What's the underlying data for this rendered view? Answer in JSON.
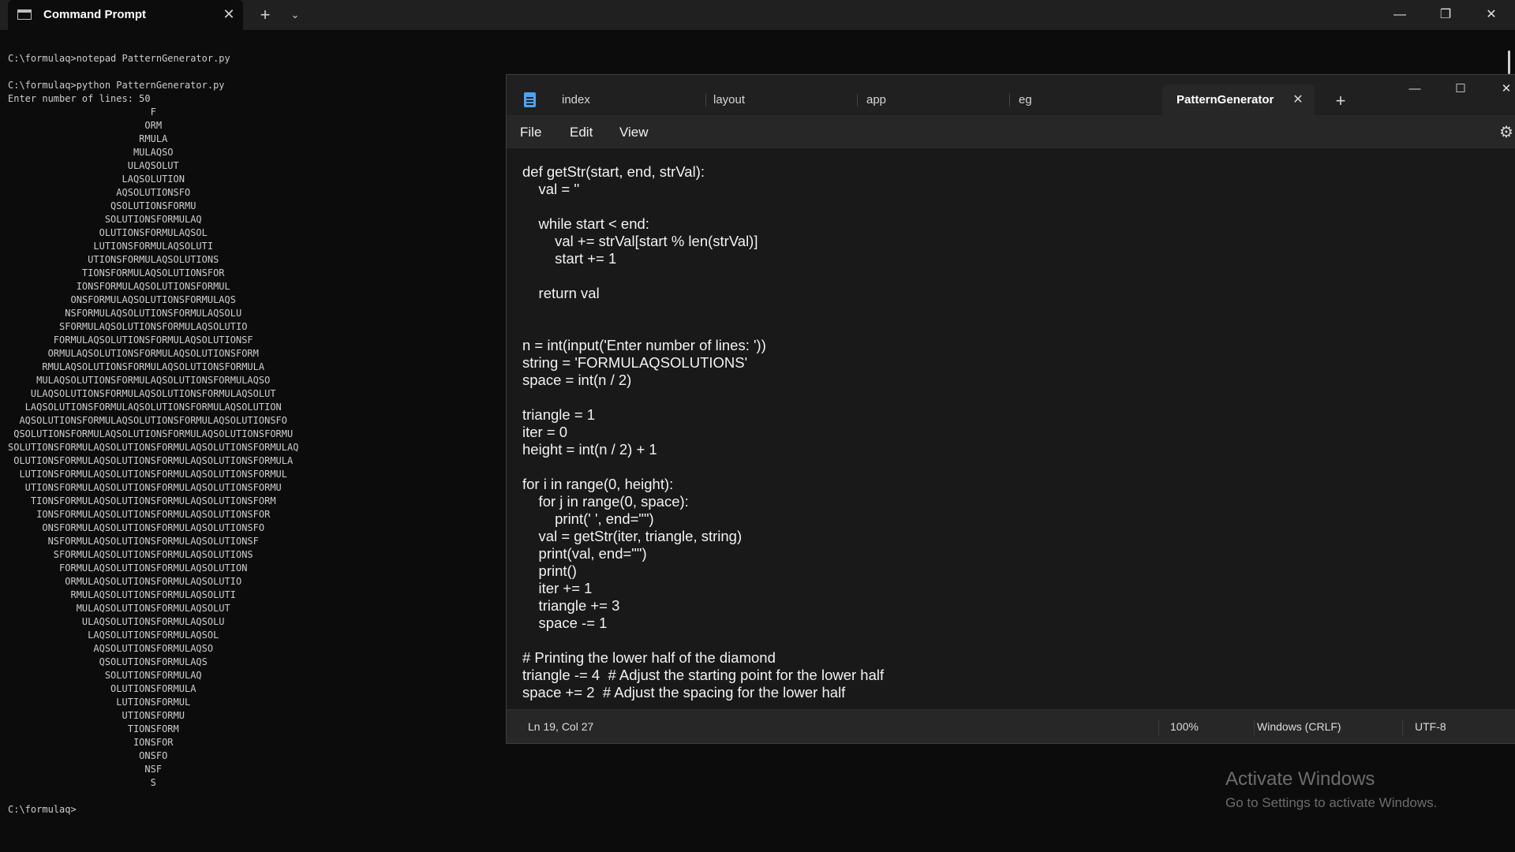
{
  "terminal": {
    "tab_title": "Command Prompt",
    "icons": {
      "tab": "terminal-icon",
      "close": "close-icon",
      "new_tab": "plus-icon",
      "dropdown": "chevron-down-icon",
      "minimize": "minimize-icon",
      "restore": "restore-icon",
      "window_close": "close-icon"
    },
    "output_lines": [
      "C:\\formulaq>notepad PatternGenerator.py",
      "",
      "C:\\formulaq>python PatternGenerator.py",
      "Enter number of lines: 50",
      "                         F",
      "                        ORM",
      "                       RMULA",
      "                      MULAQSO",
      "                     ULAQSOLUT",
      "                    LAQSOLUTION",
      "                   AQSOLUTIONSFO",
      "                  QSOLUTIONSFORMU",
      "                 SOLUTIONSFORMULAQ",
      "                OLUTIONSFORMULAQSOL",
      "               LUTIONSFORMULAQSOLUTI",
      "              UTIONSFORMULAQSOLUTIONS",
      "             TIONSFORMULAQSOLUTIONSFOR",
      "            IONSFORMULAQSOLUTIONSFORMUL",
      "           ONSFORMULAQSOLUTIONSFORMULAQS",
      "          NSFORMULAQSOLUTIONSFORMULAQSOLU",
      "         SFORMULAQSOLUTIONSFORMULAQSOLUTIO",
      "        FORMULAQSOLUTIONSFORMULAQSOLUTIONSF",
      "       ORMULAQSOLUTIONSFORMULAQSOLUTIONSFORM",
      "      RMULAQSOLUTIONSFORMULAQSOLUTIONSFORMULA",
      "     MULAQSOLUTIONSFORMULAQSOLUTIONSFORMULAQSO",
      "    ULAQSOLUTIONSFORMULAQSOLUTIONSFORMULAQSOLUT",
      "   LAQSOLUTIONSFORMULAQSOLUTIONSFORMULAQSOLUTION",
      "  AQSOLUTIONSFORMULAQSOLUTIONSFORMULAQSOLUTIONSFO",
      " QSOLUTIONSFORMULAQSOLUTIONSFORMULAQSOLUTIONSFORMU",
      "SOLUTIONSFORMULAQSOLUTIONSFORMULAQSOLUTIONSFORMULAQ",
      " OLUTIONSFORMULAQSOLUTIONSFORMULAQSOLUTIONSFORMULA",
      "  LUTIONSFORMULAQSOLUTIONSFORMULAQSOLUTIONSFORMUL",
      "   UTIONSFORMULAQSOLUTIONSFORMULAQSOLUTIONSFORMU",
      "    TIONSFORMULAQSOLUTIONSFORMULAQSOLUTIONSFORM",
      "     IONSFORMULAQSOLUTIONSFORMULAQSOLUTIONSFOR",
      "      ONSFORMULAQSOLUTIONSFORMULAQSOLUTIONSFO",
      "       NSFORMULAQSOLUTIONSFORMULAQSOLUTIONSF",
      "        SFORMULAQSOLUTIONSFORMULAQSOLUTIONS",
      "         FORMULAQSOLUTIONSFORMULAQSOLUTION",
      "          ORMULAQSOLUTIONSFORMULAQSOLUTIO",
      "           RMULAQSOLUTIONSFORMULAQSOLUTI",
      "            MULAQSOLUTIONSFORMULAQSOLUT",
      "             ULAQSOLUTIONSFORMULAQSOLU",
      "              LAQSOLUTIONSFORMULAQSOL",
      "               AQSOLUTIONSFORMULAQSO",
      "                QSOLUTIONSFORMULAQS",
      "                 SOLUTIONSFORMULAQ",
      "                  OLUTIONSFORMULA",
      "                   LUTIONSFORMUL",
      "                    UTIONSFORMU",
      "                     TIONSFORM",
      "                      IONSFOR",
      "                       ONSFO",
      "                        NSF",
      "                         S",
      "",
      "C:\\formulaq>"
    ]
  },
  "notepad": {
    "app_icon": "notepad-icon",
    "tabs": [
      {
        "label": "index"
      },
      {
        "label": "layout"
      },
      {
        "label": "app"
      },
      {
        "label": "eg"
      }
    ],
    "active_tab": {
      "label": "PatternGenerator",
      "close_icon": "close-icon"
    },
    "new_tab_icon": "plus-icon",
    "window_icons": {
      "minimize": "minimize-icon",
      "maximize": "maximize-icon",
      "close": "close-icon"
    },
    "menu": {
      "file": "File",
      "edit": "Edit",
      "view": "View"
    },
    "settings_icon": "gear-icon",
    "code_lines": [
      "def getStr(start, end, strVal):",
      "    val = ''",
      "",
      "    while start < end:",
      "        val += strVal[start % len(strVal)]",
      "        start += 1",
      "",
      "    return val",
      "",
      "",
      "n = int(input('Enter number of lines: '))",
      "string = 'FORMULAQSOLUTIONS'",
      "space = int(n / 2)",
      "",
      "triangle = 1",
      "iter = 0",
      "height = int(n / 2) + 1",
      "",
      "for i in range(0, height):",
      "    for j in range(0, space):",
      "        print(' ', end=\"\")",
      "    val = getStr(iter, triangle, string)",
      "    print(val, end=\"\")",
      "    print()",
      "    iter += 1",
      "    triangle += 3",
      "    space -= 1",
      "",
      "# Printing the lower half of the diamond",
      "triangle -= 4  # Adjust the starting point for the lower half",
      "space += 2  # Adjust the spacing for the lower half"
    ],
    "status": {
      "position": "Ln 19, Col 27",
      "zoom": "100%",
      "line_ending": "Windows (CRLF)",
      "encoding": "UTF-8"
    }
  },
  "watermark": {
    "title": "Activate Windows",
    "subtitle": "Go to Settings to activate Windows."
  },
  "colors": {
    "terminal_bg": "#0c0c0c",
    "terminal_text": "#cccccc",
    "notepad_editor_bg": "#191919",
    "notepad_chrome": "#272727",
    "accent": "#4ea3f1"
  }
}
